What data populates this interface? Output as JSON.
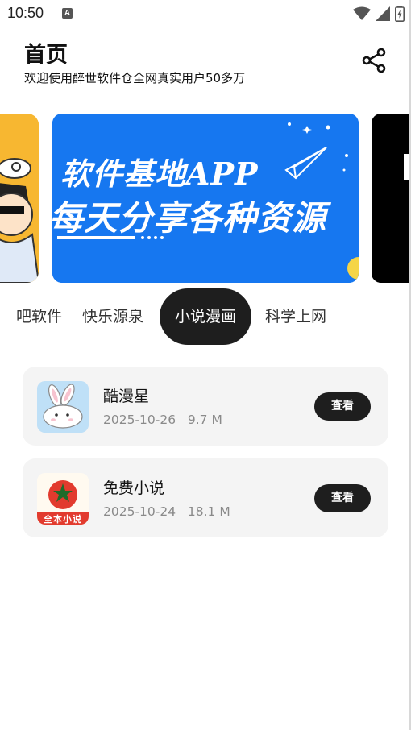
{
  "status_bar": {
    "time": "10:50",
    "notification_icon": "a-icon",
    "icons": [
      "wifi-icon",
      "signal-icon",
      "battery-icon"
    ]
  },
  "header": {
    "title": "首页",
    "subtitle": "欢迎使用醉世软件仓全网真实用户50多万",
    "share_icon": "share-icon"
  },
  "banner": {
    "line1": "软件基地APP",
    "line2": "每天分享各种资源"
  },
  "tabs": [
    {
      "label": "吧软件",
      "active": false
    },
    {
      "label": "快乐源泉",
      "active": false
    },
    {
      "label": "小说漫画",
      "active": true
    },
    {
      "label": "科学上网",
      "active": false
    }
  ],
  "apps": [
    {
      "name": "酷漫星",
      "date": "2025-10-26",
      "size": "9.7 M",
      "button": "查看",
      "icon": "rabbit-icon"
    },
    {
      "name": "免费小说",
      "date": "2025-10-24",
      "size": "18.1 M",
      "button": "查看",
      "icon": "tomato-icon",
      "icon_text": "全本小说"
    }
  ],
  "colors": {
    "banner_blue": "#1677f0",
    "active_tab": "#1e1e1e",
    "card_bg": "#f4f4f4"
  }
}
